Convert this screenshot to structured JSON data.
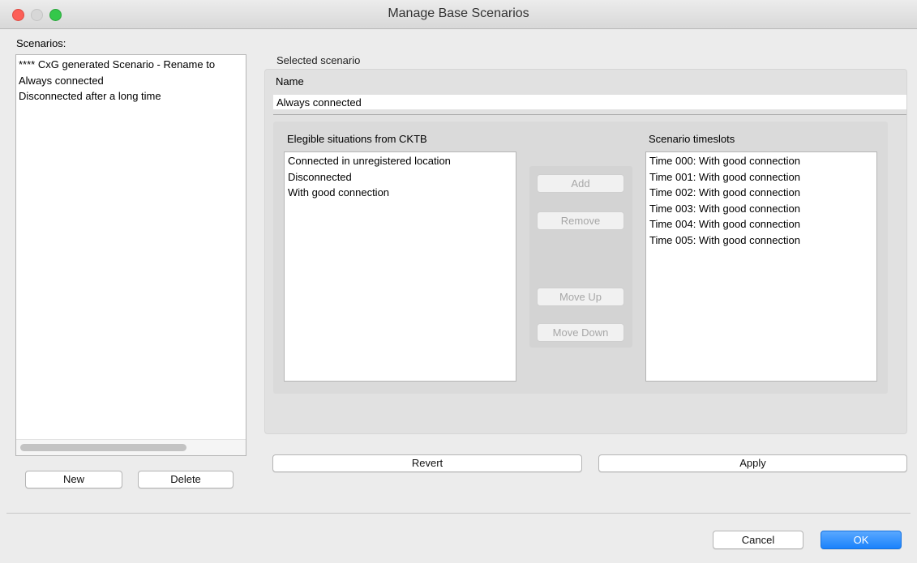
{
  "window": {
    "title": "Manage Base Scenarios"
  },
  "left": {
    "label": "Scenarios:",
    "items": [
      "**** CxG generated Scenario - Rename to",
      "Always connected",
      "Disconnected after a long time"
    ],
    "new_label": "New",
    "delete_label": "Delete"
  },
  "selected": {
    "title": "Selected scenario",
    "name_label": "Name",
    "name_value": "Always connected",
    "eligible": {
      "label": "Elegible situations from CKTB",
      "items": [
        "Connected in unregistered location",
        "Disconnected",
        "With good connection"
      ]
    },
    "timeslots": {
      "label": "Scenario timeslots",
      "items": [
        "Time 000: With good connection",
        "Time 001: With good connection",
        "Time 002: With good connection",
        "Time 003: With good connection",
        "Time 004: With good connection",
        "Time 005: With good connection"
      ]
    },
    "buttons": {
      "add": "Add",
      "remove": "Remove",
      "move_up": "Move Up",
      "move_down": "Move Down"
    }
  },
  "actions": {
    "revert": "Revert",
    "apply": "Apply"
  },
  "footer": {
    "cancel": "Cancel",
    "ok": "OK"
  },
  "colors": {
    "ok_accent": "#1a82fb",
    "close": "#fc5f57",
    "maximize": "#34c84a"
  }
}
